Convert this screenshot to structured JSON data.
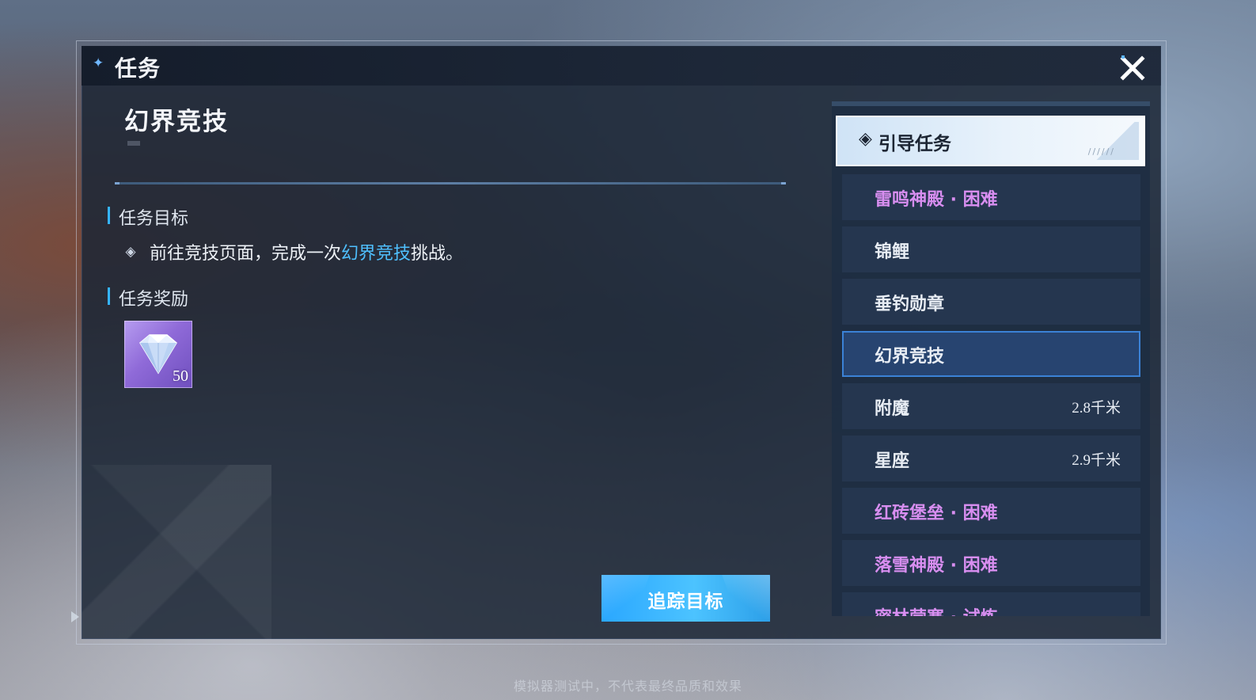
{
  "window": {
    "title": "任务",
    "close_label": "X"
  },
  "quest": {
    "title": "幻界竞技",
    "objective_label": "任务目标",
    "objective_prefix": "前往竞技页面，完成一次",
    "objective_highlight": "幻界竞技",
    "objective_suffix": "挑战。",
    "reward_label": "任务奖励",
    "rewards": [
      {
        "icon": "diamond-icon",
        "count": "50"
      }
    ],
    "track_button": "追踪目标"
  },
  "quest_list": {
    "header": {
      "icon": "◈",
      "label": "引导任务",
      "deco": "//////"
    },
    "items": [
      {
        "name": "雷鸣神殿 · 困难",
        "distance": "",
        "hard": true,
        "selected": false
      },
      {
        "name": "锦鲤",
        "distance": "",
        "hard": false,
        "selected": false
      },
      {
        "name": "垂钓勋章",
        "distance": "",
        "hard": false,
        "selected": false
      },
      {
        "name": "幻界竞技",
        "distance": "",
        "hard": false,
        "selected": true
      },
      {
        "name": "附魔",
        "distance": "2.8千米",
        "hard": false,
        "selected": false
      },
      {
        "name": "星座",
        "distance": "2.9千米",
        "hard": false,
        "selected": false
      },
      {
        "name": "红砖堡垒 · 困难",
        "distance": "",
        "hard": true,
        "selected": false
      },
      {
        "name": "落雪神殿 · 困难",
        "distance": "",
        "hard": true,
        "selected": false
      },
      {
        "name": "密林营寨 · 试炼",
        "distance": "",
        "hard": true,
        "selected": false
      }
    ]
  },
  "colors": {
    "accent": "#35b4ff",
    "hard_text": "#d88ef0",
    "track_button": "#2aa7ff",
    "reward_bg": "#8f6ad8"
  },
  "footer_note": "模拟器测试中，不代表最终品质和效果"
}
